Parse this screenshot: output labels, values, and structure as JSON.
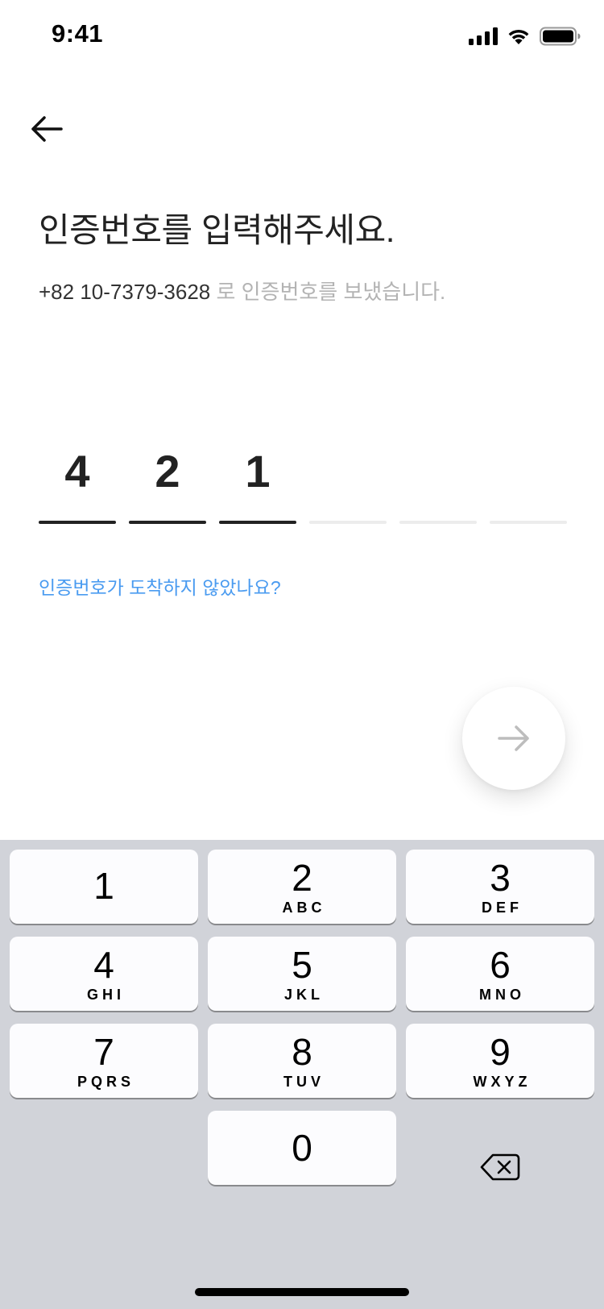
{
  "status_bar": {
    "time": "9:41"
  },
  "header": {
    "title": "인증번호를 입력해주세요.",
    "phone": "+82 10-7379-3628",
    "sent_text": " 로 인증번호를 보냈습니다."
  },
  "code": {
    "digits": [
      "4",
      "2",
      "1",
      "",
      "",
      ""
    ]
  },
  "resend_link": "인증번호가 도착하지 않았나요?",
  "keyboard": {
    "keys": [
      {
        "num": "1",
        "letters": ""
      },
      {
        "num": "2",
        "letters": "ABC"
      },
      {
        "num": "3",
        "letters": "DEF"
      },
      {
        "num": "4",
        "letters": "GHI"
      },
      {
        "num": "5",
        "letters": "JKL"
      },
      {
        "num": "6",
        "letters": "MNO"
      },
      {
        "num": "7",
        "letters": "PQRS"
      },
      {
        "num": "8",
        "letters": "TUV"
      },
      {
        "num": "9",
        "letters": "WXYZ"
      },
      {
        "num": "0",
        "letters": ""
      }
    ]
  },
  "colors": {
    "accent_link": "#4a9bf0",
    "keyboard_bg": "#d1d3d9",
    "filled_underline": "#222222",
    "empty_underline": "#ececec"
  }
}
